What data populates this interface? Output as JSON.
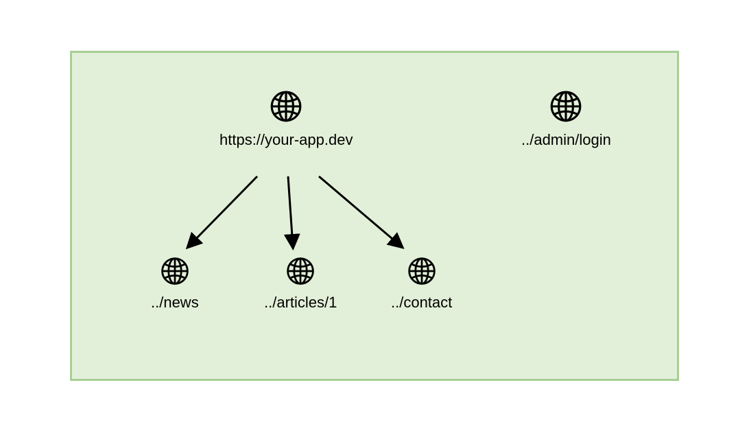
{
  "nodes": {
    "root": {
      "label": "https://your-app.dev"
    },
    "admin": {
      "label": "../admin/login"
    },
    "news": {
      "label": "../news"
    },
    "articles": {
      "label": "../articles/1"
    },
    "contact": {
      "label": "../contact"
    }
  },
  "icons": {
    "globe": "globe-icon"
  }
}
